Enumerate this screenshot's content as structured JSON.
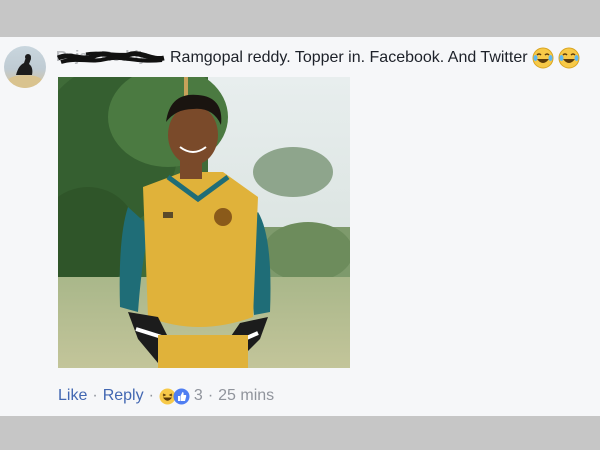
{
  "comment": {
    "author_name": "Rajan Reddy",
    "text": "Ramgopal reddy. Topper in. Facebook. And Twitter",
    "emojis": [
      "laughing-tears-emoji",
      "laughing-tears-emoji"
    ]
  },
  "actions": {
    "like_label": "Like",
    "reply_label": "Reply",
    "separator": "·",
    "reaction_icons": [
      "haha-reaction-icon",
      "like-reaction-icon"
    ],
    "reaction_count": "3",
    "timestamp": "25 mins"
  },
  "colors": {
    "link": "#4267b2",
    "meta": "#90949c",
    "text": "#1d2129",
    "card_bg": "#f6f7f9",
    "frame_bg": "#c6c6c6"
  }
}
